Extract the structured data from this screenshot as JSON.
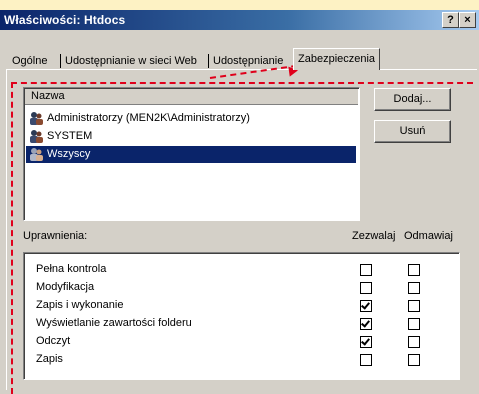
{
  "window": {
    "title": "Właściwości: Htdocs",
    "help_glyph": "?",
    "close_glyph": "×"
  },
  "tabs": [
    {
      "label": "Ogólne",
      "active": false
    },
    {
      "label": "Udostępnianie w sieci Web",
      "active": false
    },
    {
      "label": "Udostępnianie",
      "active": false
    },
    {
      "label": "Zabezpieczenia",
      "active": true
    }
  ],
  "users": {
    "column_header": "Nazwa",
    "rows": [
      {
        "name": "Administratorzy (MEN2K\\Administratorzy)",
        "icon": "users-group-icon",
        "selected": false
      },
      {
        "name": "SYSTEM",
        "icon": "users-group-icon",
        "selected": false
      },
      {
        "name": "Wszyscy",
        "icon": "users-group-icon",
        "selected": true
      }
    ]
  },
  "buttons": {
    "add_label": "Dodaj...",
    "remove_label": "Usuń"
  },
  "permissions": {
    "label": "Uprawnienia:",
    "allow_header": "Zezwalaj",
    "deny_header": "Odmawiaj",
    "rows": [
      {
        "label": "Pełna kontrola",
        "allow": false,
        "deny": false
      },
      {
        "label": "Modyfikacja",
        "allow": false,
        "deny": false
      },
      {
        "label": "Zapis i wykonanie",
        "allow": true,
        "deny": false
      },
      {
        "label": "Wyświetlanie zawartości folderu",
        "allow": true,
        "deny": false
      },
      {
        "label": "Odczyt",
        "allow": true,
        "deny": false
      },
      {
        "label": "Zapis",
        "allow": false,
        "deny": false
      }
    ]
  },
  "colors": {
    "selection": "#0a246a",
    "annotation": "#e0001b"
  }
}
